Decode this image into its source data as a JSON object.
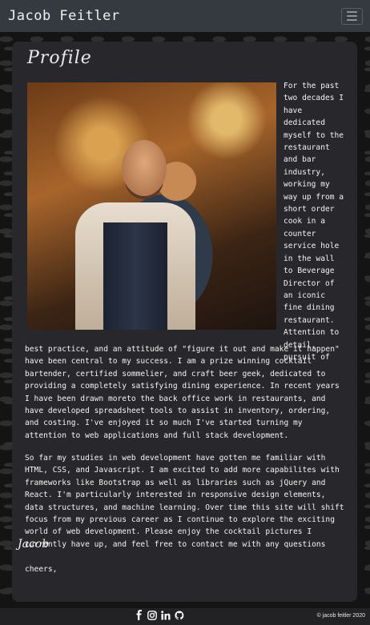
{
  "nav": {
    "brand": "Jacob Feitler",
    "menu_icon": "hamburger-menu-icon"
  },
  "profile": {
    "title": "Profile",
    "photo": "bartender-portrait",
    "side_lines": [
      "For the past",
      "two decades I",
      "have",
      "dedicated",
      "myself to the",
      "restaurant",
      "and bar",
      "industry,",
      "working my",
      "way up from a",
      "short order",
      "cook in a",
      "counter",
      "service hole",
      "in the wall",
      "to Beverage",
      "Director of",
      "an iconic",
      "fine dining",
      "restaurant.",
      "Attention to",
      "detail,",
      "pursuit of"
    ],
    "lines_1": [
      "best practice, and an attitude of \"figure it out and make it happen\"",
      "have been central to my success. I am a prize winning cocktail",
      "bartender, certified sommelier, and craft beer geek, dedicated to",
      "providing a completely satisfying dining experience. In recent years",
      "I have been drawn moreto the back office work in restaurants, and",
      "have developed spreadsheet tools to assist in inventory, ordering,",
      "and costing. I've enjoyed it so much I've started turning my",
      "attention to web applications and full stack development."
    ],
    "lines_2": [
      "So far my studies in web development have gotten me familiar with",
      "HTML, CSS, and Javascript. I am excited to add more capabilites with",
      "frameworks like Bootstrap as well as libraries such as jQuery and",
      "React. I'm particularly interested in responsive design elements,",
      "data structures, and machine learning. Over time this site will shift",
      "focus from my previous career as I continue to explore the exciting",
      "world of web development. Please enjoy the cocktail pictures I",
      "currently have up, and feel free to contact me with any questions"
    ],
    "closing": "cheers,",
    "signature": "Jacob"
  },
  "footer": {
    "icons": [
      "facebook-icon",
      "instagram-icon",
      "linkedin-icon",
      "github-icon"
    ],
    "copyright": "© jacob feitler 2020"
  }
}
